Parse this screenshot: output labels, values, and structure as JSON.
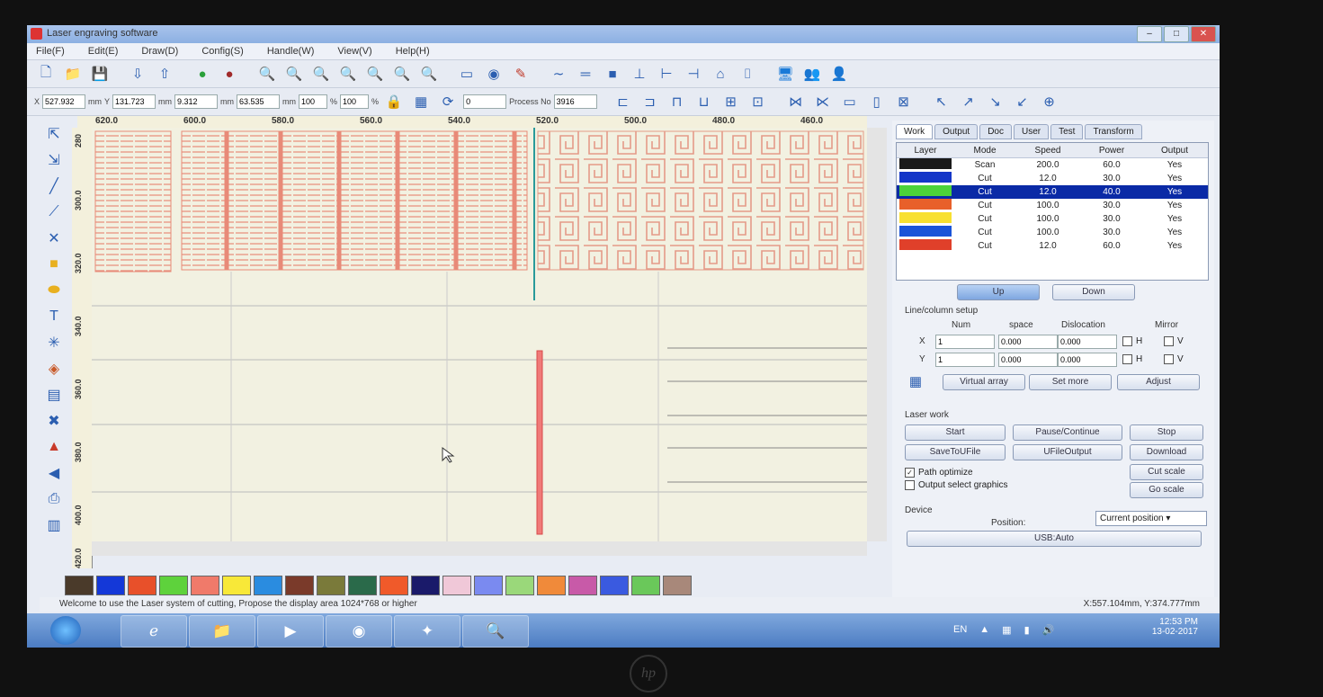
{
  "window": {
    "title": "Laser engraving software"
  },
  "menu": [
    "File(F)",
    "Edit(E)",
    "Draw(D)",
    "Config(S)",
    "Handle(W)",
    "View(V)",
    "Help(H)"
  ],
  "coords": {
    "x_label": "X",
    "x_value": "527.932",
    "x_unit": "mm",
    "y_label": "Y",
    "y_value": "131.723",
    "y_unit": "mm",
    "w_value": "9.312",
    "w_unit": "mm",
    "h_value": "63.535",
    "h_unit": "mm",
    "sx_value": "100",
    "sx_unit": "%",
    "sy_value": "100",
    "sy_unit": "%",
    "angle_value": "0",
    "process_no_label": "Process No",
    "process_no_value": "3916"
  },
  "ruler": {
    "h": [
      "620.0",
      "600.0",
      "580.0",
      "560.0",
      "540.0",
      "520.0",
      "500.0",
      "480.0",
      "460.0"
    ],
    "v": [
      "280",
      "300.0",
      "320.0",
      "340.0",
      "360.0",
      "380.0",
      "400.0",
      "420.0"
    ]
  },
  "palette": [
    "#4a3a2a",
    "#1438d8",
    "#e8502a",
    "#5ed23c",
    "#f07a6a",
    "#f8e838",
    "#2a8ce0",
    "#7a3a2a",
    "#7a7a3a",
    "#2a6a4a",
    "#f05a2a",
    "#1a1a6a",
    "#f0c8d8",
    "#7a8af0",
    "#9ad87a",
    "#f08a3a",
    "#c85aa8",
    "#3a5ae0",
    "#6ac85a",
    "#a8887a"
  ],
  "status": {
    "message": "Welcome to use the Laser system of cutting, Propose the display area 1024*768 or higher",
    "position": "X:557.104mm, Y:374.777mm"
  },
  "panel": {
    "tabs": [
      "Work",
      "Output",
      "Doc",
      "User",
      "Test",
      "Transform"
    ],
    "layer_headers": [
      "Layer",
      "Mode",
      "Speed",
      "Power",
      "Output"
    ],
    "layers": [
      {
        "color": "#1a1a1a",
        "mode": "Scan",
        "speed": "200.0",
        "power": "60.0",
        "output": "Yes"
      },
      {
        "color": "#1436c8",
        "mode": "Cut",
        "speed": "12.0",
        "power": "30.0",
        "output": "Yes"
      },
      {
        "color": "#4cd23a",
        "mode": "Cut",
        "speed": "12.0",
        "power": "40.0",
        "output": "Yes"
      },
      {
        "color": "#e8602a",
        "mode": "Cut",
        "speed": "100.0",
        "power": "30.0",
        "output": "Yes"
      },
      {
        "color": "#f8e030",
        "mode": "Cut",
        "speed": "100.0",
        "power": "30.0",
        "output": "Yes"
      },
      {
        "color": "#1a54d8",
        "mode": "Cut",
        "speed": "100.0",
        "power": "30.0",
        "output": "Yes"
      },
      {
        "color": "#e0402a",
        "mode": "Cut",
        "speed": "12.0",
        "power": "60.0",
        "output": "Yes"
      }
    ],
    "up_label": "Up",
    "down_label": "Down",
    "linecol_title": "Line/column setup",
    "linecol_headers": [
      "Num",
      "space",
      "Dislocation",
      "Mirror"
    ],
    "x_label": "X",
    "y_label": "Y",
    "x_num": "1",
    "x_space": "0.000",
    "x_disloc": "0.000",
    "y_num": "1",
    "y_space": "0.000",
    "y_disloc": "0.000",
    "mirror_h": "H",
    "mirror_v": "V",
    "array_btn": "Virtual array",
    "setmore_btn": "Set more",
    "adjust_btn": "Adjust",
    "laser_title": "Laser work",
    "start_btn": "Start",
    "pause_btn": "Pause/Continue",
    "stop_btn": "Stop",
    "save_btn": "SaveToUFile",
    "udisk_btn": "UFileOutput",
    "download_btn": "Download",
    "path_opt": "Path optimize",
    "output_sel": "Output select graphics",
    "cut_scale_btn": "Cut scale",
    "go_scale_btn": "Go scale",
    "device_title": "Device",
    "position_label": "Position:",
    "position_value": "Current position",
    "usb_btn": "USB:Auto"
  },
  "taskbar": {
    "lang": "EN",
    "time": "12:53 PM",
    "date": "13-02-2017"
  }
}
